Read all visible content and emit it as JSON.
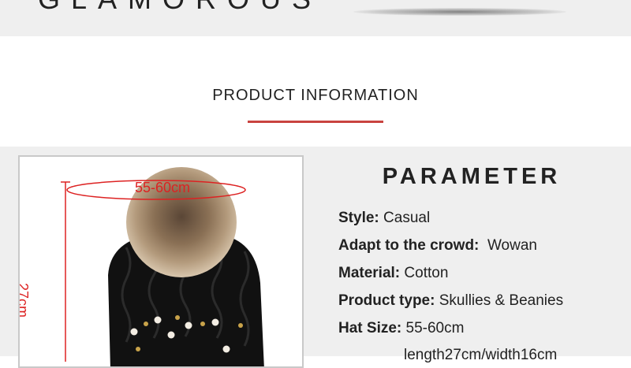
{
  "header": {
    "brand": "GLAMOROUS"
  },
  "section": {
    "title": "PRODUCT INFORMATION"
  },
  "image": {
    "circumference_label": "55-60cm",
    "height_label": "27cm"
  },
  "parameters": {
    "title": "PARAMETER",
    "rows": [
      {
        "key": "Style:",
        "value": "Casual"
      },
      {
        "key": "Adapt to the crowd:",
        "value": "Wowan"
      },
      {
        "key": "Material:",
        "value": "Cotton"
      },
      {
        "key": "Product type:",
        "value": "Skullies & Beanies"
      },
      {
        "key": "Hat Size:",
        "value": "55-60cm"
      }
    ],
    "extra": "length27cm/width16cm"
  },
  "colors": {
    "accent_red": "#c9433f",
    "band_grey": "#efefef",
    "dimension_red": "#d22222"
  }
}
